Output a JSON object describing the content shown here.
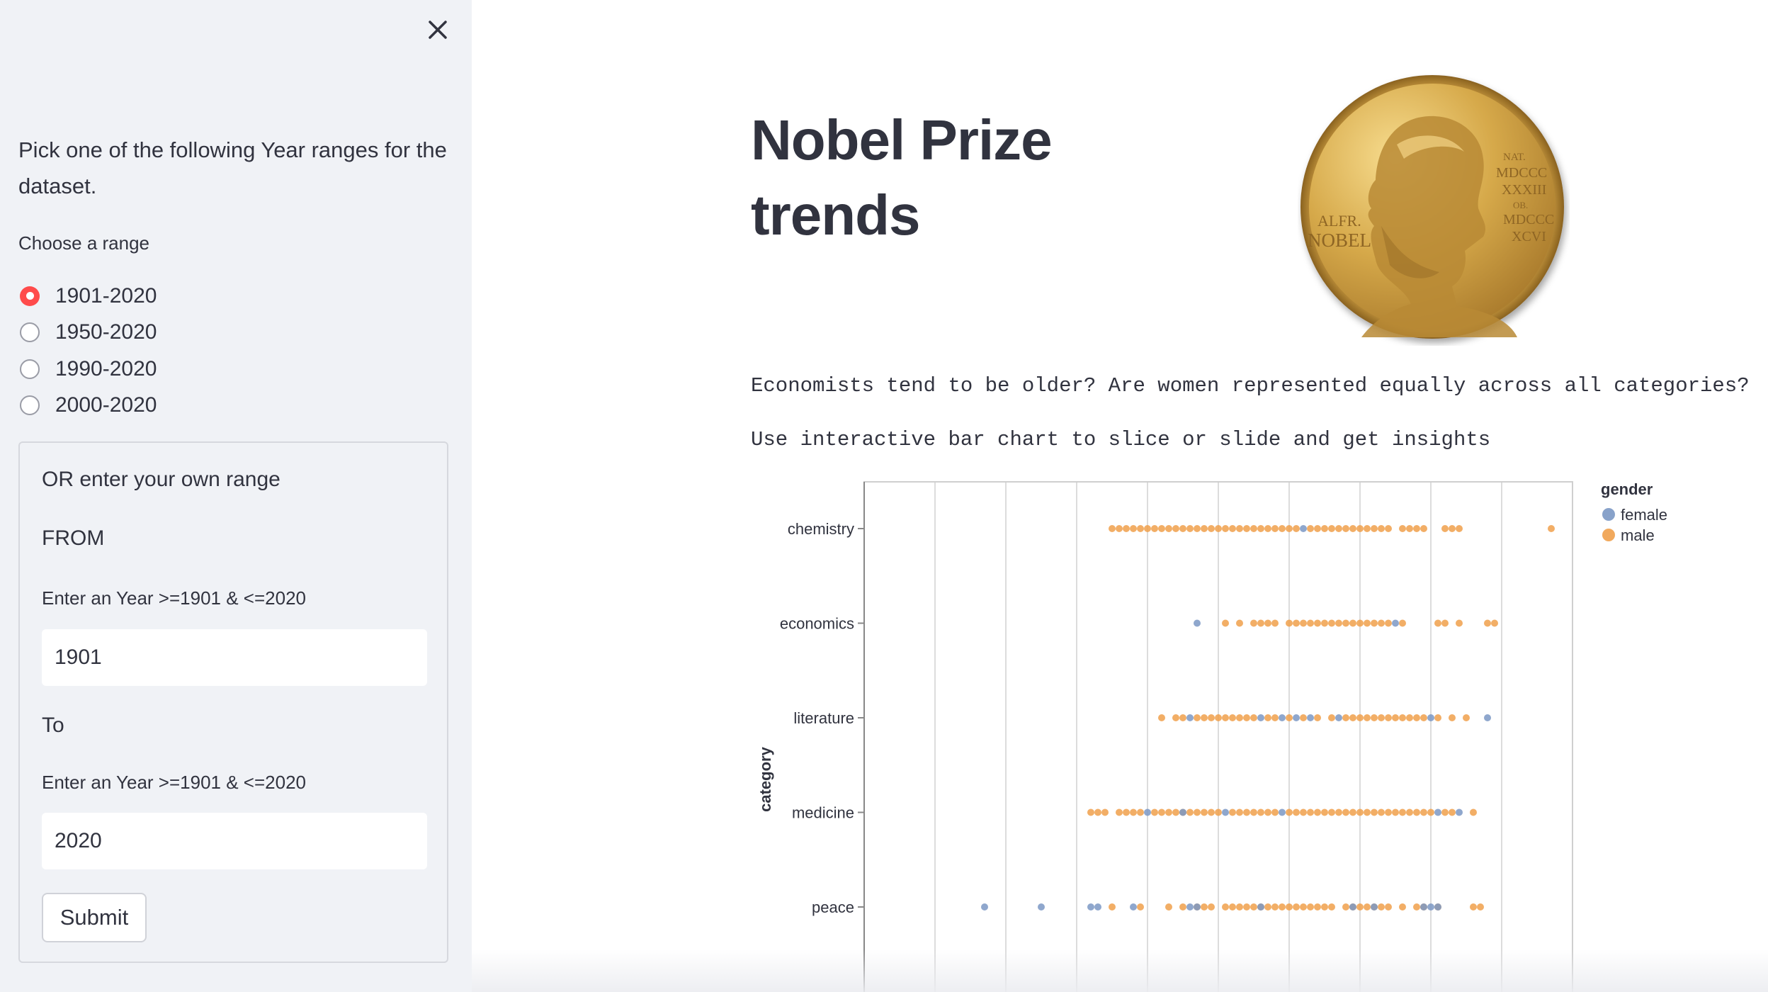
{
  "sidebar": {
    "intro_text": "Pick one of the following Year ranges for the dataset.",
    "choose_label": "Choose a range",
    "ranges": [
      {
        "label": "1901-2020",
        "selected": true
      },
      {
        "label": "1950-2020",
        "selected": false
      },
      {
        "label": "1990-2020",
        "selected": false
      },
      {
        "label": "2000-2020",
        "selected": false
      }
    ],
    "form": {
      "heading": "OR enter your own range",
      "from_label": "FROM",
      "from_hint": "Enter an Year >=1901 & <=2020",
      "from_value": "1901",
      "to_label": "To",
      "to_hint": "Enter an Year >=1901 & <=2020",
      "to_value": "2020",
      "submit_label": "Submit"
    },
    "accent_color": "#ff4b4b"
  },
  "main": {
    "title_line1": "Nobel Prize",
    "title_line2": "trends",
    "medal_text": {
      "name_line1": "ALFR.",
      "name_line2": "NOBEL",
      "nat": "NAT.",
      "year1": "MDCCC",
      "year2": "XXXIII",
      "ob": "OB.",
      "year3": "MDCCC",
      "year4": "XCVI"
    },
    "question_text": "Economists tend to be older? Are women represented equally across all categories?",
    "hint_text": "Use interactive bar chart to slice or slide and get insights"
  },
  "chart_data": {
    "type": "scatter",
    "y_title": "category",
    "categories": [
      "chemistry",
      "economics",
      "literature",
      "medicine",
      "peace"
    ],
    "legend": {
      "title": "gender",
      "entries": [
        {
          "name": "female",
          "color": "#7b98c4"
        },
        {
          "name": "male",
          "color": "#f0a04b"
        }
      ]
    },
    "x_range": [
      0,
      10
    ],
    "grid": true,
    "legend_placement": "top-right",
    "series": [
      {
        "name": "male",
        "color": "#f0a04b",
        "points": [
          {
            "category": "chemistry",
            "x": [
              3.5,
              3.6,
              3.7,
              3.8,
              3.9,
              4.0,
              4.1,
              4.2,
              4.3,
              4.4,
              4.5,
              4.6,
              4.7,
              4.8,
              4.9,
              5.0,
              5.1,
              5.2,
              5.3,
              5.4,
              5.5,
              5.6,
              5.7,
              5.8,
              5.9,
              6.0,
              6.1,
              6.3,
              6.4,
              6.5,
              6.6,
              6.7,
              6.8,
              6.9,
              7.0,
              7.1,
              7.2,
              7.3,
              7.4,
              7.6,
              7.7,
              7.8,
              7.9,
              8.2,
              8.3,
              8.4,
              9.7
            ]
          },
          {
            "category": "economics",
            "x": [
              5.1,
              5.3,
              5.5,
              5.6,
              5.7,
              5.8,
              6.0,
              6.1,
              6.2,
              6.3,
              6.4,
              6.5,
              6.6,
              6.7,
              6.8,
              6.9,
              7.0,
              7.1,
              7.2,
              7.3,
              7.4,
              7.6,
              8.1,
              8.2,
              8.4,
              8.8,
              8.9
            ]
          },
          {
            "category": "literature",
            "x": [
              4.2,
              4.4,
              4.5,
              4.7,
              4.8,
              4.9,
              5.0,
              5.1,
              5.2,
              5.3,
              5.4,
              5.5,
              5.7,
              5.8,
              6.0,
              6.2,
              6.4,
              6.6,
              6.8,
              6.9,
              7.0,
              7.1,
              7.2,
              7.3,
              7.4,
              7.5,
              7.6,
              7.7,
              7.8,
              7.9,
              8.1,
              8.3,
              8.5
            ]
          },
          {
            "category": "medicine",
            "x": [
              3.2,
              3.3,
              3.4,
              3.6,
              3.7,
              3.8,
              3.9,
              4.1,
              4.2,
              4.3,
              4.4,
              4.5,
              4.6,
              4.7,
              4.8,
              4.9,
              5.0,
              5.2,
              5.3,
              5.4,
              5.5,
              5.6,
              5.7,
              5.8,
              6.0,
              6.1,
              6.2,
              6.3,
              6.4,
              6.5,
              6.6,
              6.7,
              6.8,
              6.9,
              7.0,
              7.1,
              7.2,
              7.3,
              7.4,
              7.5,
              7.6,
              7.7,
              7.8,
              7.9,
              8.0,
              8.2,
              8.3,
              8.6
            ]
          },
          {
            "category": "peace",
            "x": [
              3.5,
              3.9,
              4.3,
              4.5,
              4.7,
              4.8,
              4.9,
              5.1,
              5.2,
              5.3,
              5.4,
              5.5,
              5.6,
              5.7,
              5.8,
              5.9,
              6.0,
              6.1,
              6.2,
              6.3,
              6.4,
              6.5,
              6.6,
              6.8,
              6.9,
              7.0,
              7.1,
              7.2,
              7.3,
              7.4,
              7.6,
              7.8,
              7.9,
              8.1,
              8.6,
              8.7
            ]
          }
        ]
      },
      {
        "name": "female",
        "color": "#7b98c4",
        "points": [
          {
            "category": "chemistry",
            "x": [
              6.2
            ]
          },
          {
            "category": "economics",
            "x": [
              4.7,
              7.5
            ]
          },
          {
            "category": "literature",
            "x": [
              4.6,
              5.6,
              5.9,
              6.1,
              6.3,
              6.7,
              8.0,
              8.8
            ]
          },
          {
            "category": "medicine",
            "x": [
              4.0,
              4.5,
              5.1,
              5.9,
              8.1,
              8.4
            ]
          },
          {
            "category": "peace",
            "x": [
              1.7,
              2.5,
              3.2,
              3.3,
              3.8,
              4.6,
              4.7,
              5.6,
              6.9,
              7.2,
              7.9,
              8.0,
              8.1
            ]
          }
        ]
      }
    ]
  }
}
